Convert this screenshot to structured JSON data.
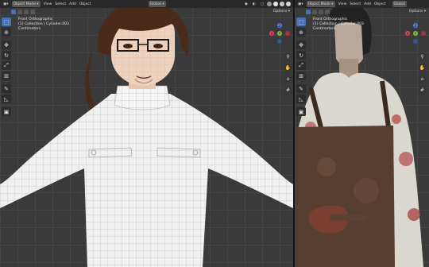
{
  "left_viewport": {
    "header": {
      "mode": "Object Mode",
      "menus": [
        "View",
        "Select",
        "Add",
        "Object"
      ],
      "transform": "Global"
    },
    "options": "Options",
    "info": {
      "view": "Front Orthographic",
      "collection": "(1) Collection | Cylinder.003",
      "units": "Centimeters"
    },
    "gizmo": {
      "x": "X",
      "y": "Y",
      "z": "Z"
    }
  },
  "right_viewport": {
    "header": {
      "mode": "Object Mode",
      "menus": [
        "View",
        "Select",
        "Add",
        "Object"
      ],
      "transform": "Global"
    },
    "options": "Options",
    "info": {
      "view": "Front Orthographic",
      "collection": "(1) Collection | Cylinder.003",
      "units": "Centimeters"
    },
    "gizmo": {
      "x": "X",
      "y": "Y",
      "z": "Z"
    }
  },
  "colors": {
    "accent": "#4772b3",
    "axis_x": "#e0475a",
    "axis_y": "#7fbf3b",
    "axis_z": "#4b87e0"
  },
  "icons": [
    "select-box-icon",
    "cursor-icon",
    "move-icon",
    "rotate-icon",
    "scale-icon",
    "transform-icon",
    "annotate-icon",
    "measure-icon",
    "add-cube-icon",
    "zoom-icon",
    "hand-icon",
    "camera-icon",
    "grid-icon"
  ]
}
